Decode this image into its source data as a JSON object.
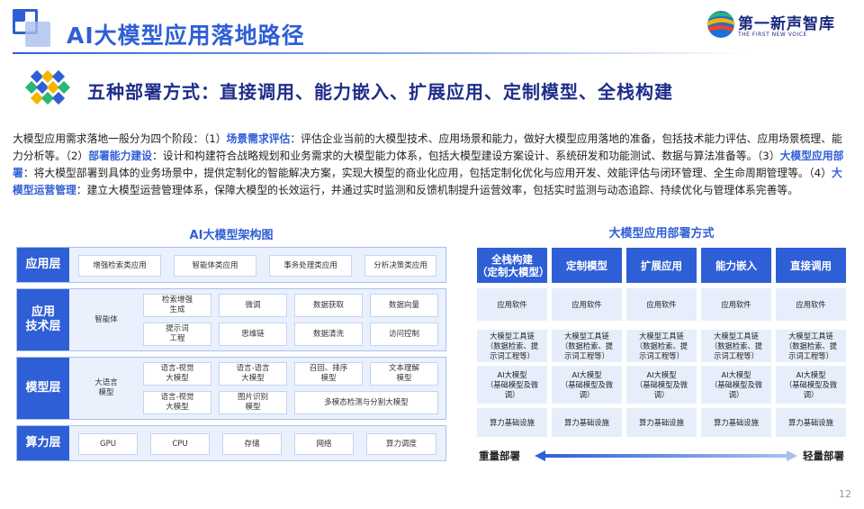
{
  "header": {
    "title": "AI大模型应用落地路径",
    "logo_text": "第一新声智库",
    "logo_sub": "THE FIRST NEW VOICE"
  },
  "subtitle": "五种部署方式：直接调用、能力嵌入、扩展应用、定制模型、全栈构建",
  "intro": [
    {
      "t": "大模型应用需求落地一般分为四个阶段：（1）",
      "hl": false
    },
    {
      "t": "场景需求评估",
      "hl": true
    },
    {
      "t": "：评估企业当前的大模型技术、应用场景和能力，做好大模型应用落地的准备，包括技术能力评估、应用场景梳理、能力分析等。（2）",
      "hl": false
    },
    {
      "t": "部署能力建设",
      "hl": true
    },
    {
      "t": "：设计和构建符合战略规划和业务需求的大模型能力体系，包括大模型建设方案设计、系统研发和功能测试、数据与算法准备等。（3）",
      "hl": false
    },
    {
      "t": "大模型应用部署",
      "hl": true
    },
    {
      "t": "：将大模型部署到具体的业务场景中，提供定制化的智能解决方案，实现大模型的商业化应用，包括定制化优化与应用开发、效能评估与闭环管理、全生命周期管理等。（4）",
      "hl": false
    },
    {
      "t": "大模型运营管理",
      "hl": true
    },
    {
      "t": "：建立大模型运营管理体系，保障大模型的长效运行，并通过实时监测和反馈机制提升运营效率，包括实时监测与动态追踪、持续优化与管理体系完善等。",
      "hl": false
    }
  ],
  "architecture": {
    "title": "AI大模型架构图",
    "app_layer": {
      "label": "应用层",
      "items": [
        "增强检索类应用",
        "智能体类应用",
        "事务处理类应用",
        "分析决策类应用"
      ]
    },
    "tech_layer": {
      "label": "应用\n技术层",
      "left": "智能体",
      "items": [
        "检索增强\n生成",
        "微调",
        "数据获取",
        "数据向量",
        "提示词\n工程",
        "思维链",
        "数据清洗",
        "访问控制"
      ]
    },
    "model_layer": {
      "label": "模型层",
      "left": "大语言\n模型",
      "items": [
        "语言-视觉\n大模型",
        "语言-语言\n大模型",
        "召回、排序\n模型",
        "文本理解\n模型",
        "语言-视觉\n大模型",
        "图片识别\n模型",
        "多模态检测与分割大模型"
      ]
    },
    "compute_layer": {
      "label": "算力层",
      "items": [
        "GPU",
        "CPU",
        "存储",
        "网络",
        "算力调度"
      ]
    }
  },
  "deployment": {
    "title": "大模型应用部署方式",
    "columns": [
      "全栈构建\n（定制大模型）",
      "定制模型",
      "扩展应用",
      "能力嵌入",
      "直接调用"
    ],
    "rows": [
      [
        "应用软件",
        "应用软件",
        "应用软件",
        "应用软件",
        "应用软件"
      ],
      [
        "大模型工具链\n（数据检索、提\n示词工程等）",
        "大模型工具链\n（数据检索、提\n示词工程等）",
        "大模型工具链\n（数据检索、提\n示词工程等）",
        "大模型工具链\n（数据检索、提\n示词工程等）",
        "大模型工具链\n（数据检索、提\n示词工程等）"
      ],
      [
        "AI大模型\n（基础模型及微\n调）",
        "AI大模型\n（基础模型及微\n调）",
        "AI大模型\n（基础模型及微\n调）",
        "AI大模型\n（基础模型及微\n调）",
        "AI大模型\n（基础模型及微\n调）"
      ],
      [
        "算力基础设施",
        "算力基础设施",
        "算力基础设施",
        "算力基础设施",
        "算力基础设施"
      ]
    ],
    "axis_left": "重量部署",
    "axis_right": "轻量部署"
  },
  "page_number": "12",
  "colors": {
    "primary": "#2f5fd6",
    "navy": "#1f2d8a",
    "panel": "#eaf1fd"
  }
}
